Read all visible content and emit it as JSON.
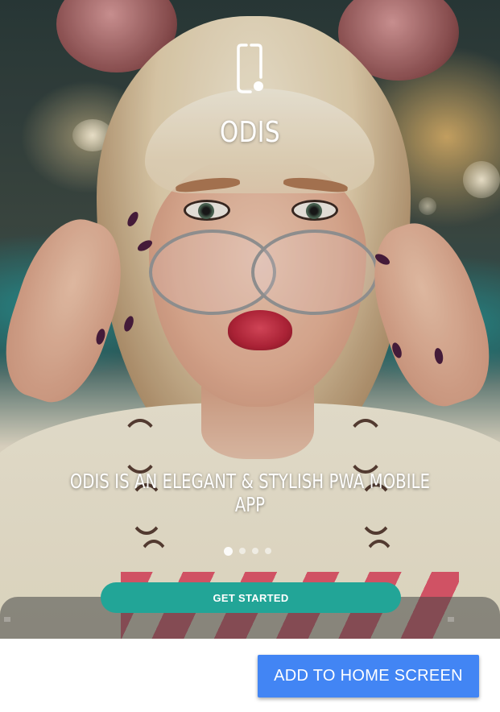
{
  "app": {
    "title": "ODIS",
    "logo_icon": "phone-outline-icon"
  },
  "slider": {
    "tagline": "ODIS IS AN ELEGANT & STYLISH PWA MOBILE APP",
    "slide_count": 4,
    "active_slide": 1
  },
  "actions": {
    "get_started_label": "GET STARTED",
    "add_to_home_label": "ADD TO HOME SCREEN"
  },
  "colors": {
    "accent_teal": "#22a597",
    "install_blue": "#4285f4"
  }
}
